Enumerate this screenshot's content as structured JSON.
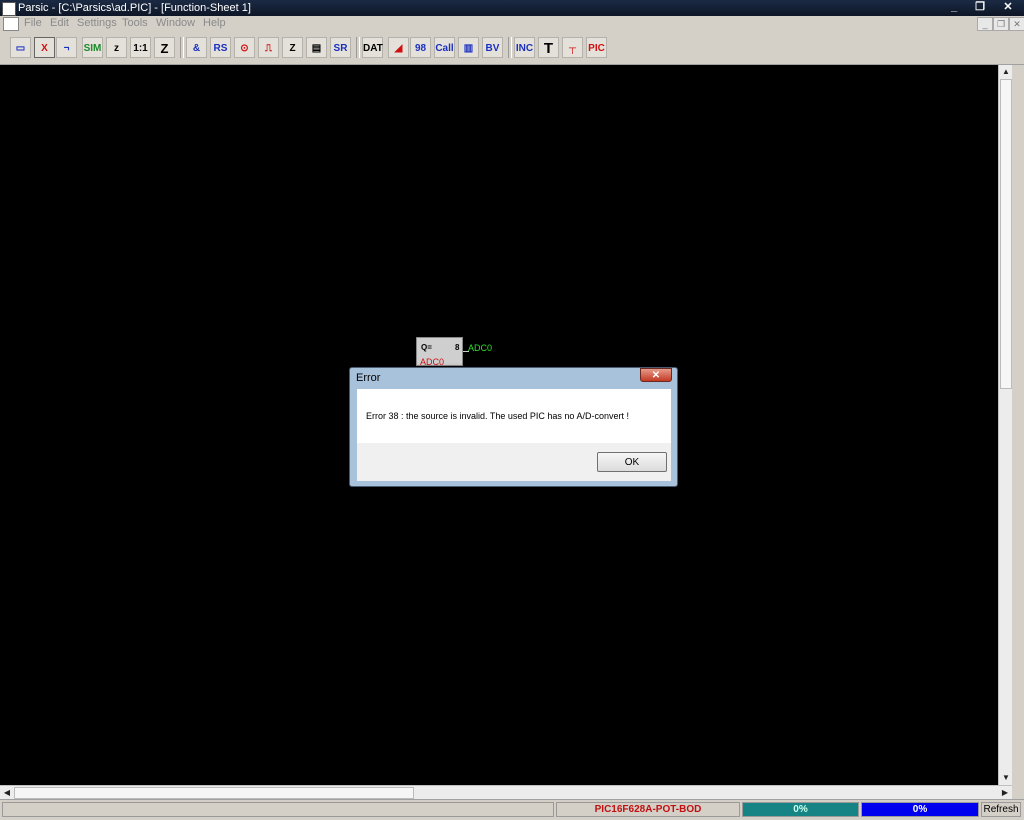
{
  "window": {
    "title": "Parsic - [C:\\Parsics\\ad.PIC] - [Function-Sheet 1]",
    "minimize": "_",
    "maximize": "❐",
    "close": "✕"
  },
  "menu": {
    "items": [
      "File",
      "Edit",
      "Settings",
      "Tools",
      "Window",
      "Help"
    ],
    "mdi": [
      "_",
      "❐",
      "✕"
    ]
  },
  "toolbar": {
    "buttons": [
      "▭",
      "X",
      "¬",
      "SIM",
      "z",
      "1:1",
      "Z",
      "&",
      "RS",
      "⊙",
      "⎍",
      "Z",
      "▤",
      "SR",
      "DAT",
      "◢",
      "98",
      "Call",
      "▥",
      "BV",
      "INC",
      "T",
      "┬",
      "PIC"
    ]
  },
  "canvas": {
    "block": {
      "q_label": "Q=",
      "value": "8",
      "name": "ADC0",
      "output_label": "ADC0"
    }
  },
  "scroll": {
    "up": "▲",
    "down": "▼",
    "left": "◀",
    "right": "▶"
  },
  "status": {
    "device": "PIC16F628A-POT-BOD",
    "progress1": "0%",
    "progress2": "0%",
    "refresh": "Refresh"
  },
  "dialog": {
    "title": "Error",
    "close": "✕",
    "message": "Error 38 : the source is invalid. The used PIC has no A/D-convert !",
    "ok": "OK"
  },
  "colors": {
    "canvas": "#000000",
    "block_name": "#d01010",
    "output_label": "#2ee02e",
    "progress1": "#168484",
    "progress2": "#0000ee"
  }
}
